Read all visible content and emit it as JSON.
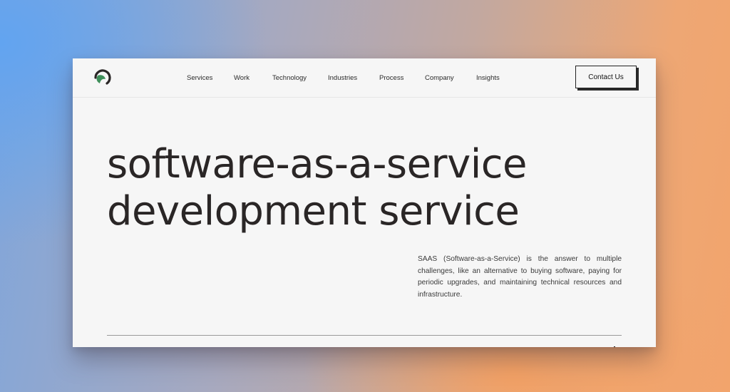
{
  "header": {
    "logo_name": "spartan-helmet-logo",
    "nav": [
      {
        "label": "Services"
      },
      {
        "label": "Work"
      },
      {
        "label": "Technology"
      },
      {
        "label": "Industries"
      },
      {
        "label": "Process"
      },
      {
        "label": "Company"
      },
      {
        "label": "Insights"
      }
    ],
    "cta_label": "Contact Us"
  },
  "hero": {
    "title_line1": "software-as-a-service",
    "title_line2": "development service",
    "description": "SAAS (Software-as-a-Service) is the answer to multiple challenges, like an alternative to buying software, paying for periodic upgrades, and maintaining technical resources and infrastructure."
  },
  "colors": {
    "accent_green": "#3f8f5a",
    "text_dark": "#2a2626",
    "page_bg": "#f6f6f6"
  }
}
